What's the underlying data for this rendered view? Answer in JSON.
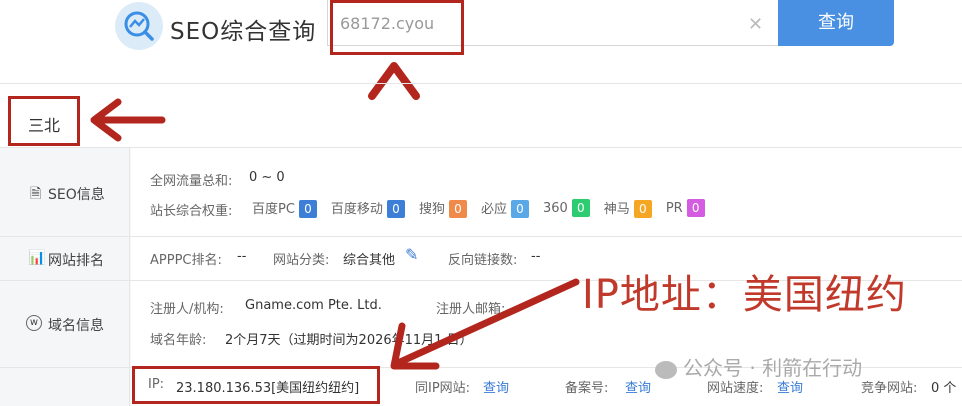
{
  "header": {
    "brand": "SEO综合查询",
    "search_value": "68172.cyou",
    "search_button": "查询"
  },
  "tab": {
    "label": "三北"
  },
  "seo_info": {
    "label": "SEO信息",
    "traffic_label": "全网流量总和:",
    "traffic_value": "0 ~ 0",
    "weight_label": "站长综合权重:",
    "engines": [
      {
        "name": "百度PC",
        "value": "0",
        "color": "#3d7fd6"
      },
      {
        "name": "百度移动",
        "value": "0",
        "color": "#3d7fd6"
      },
      {
        "name": "搜狗",
        "value": "0",
        "color": "#f08a4b"
      },
      {
        "name": "必应",
        "value": "0",
        "color": "#5aa9e6"
      },
      {
        "name": "360",
        "value": "0",
        "color": "#2ecc71"
      },
      {
        "name": "神马",
        "value": "0",
        "color": "#f5a623"
      },
      {
        "name": "PR",
        "value": "0",
        "color": "#d35ce0"
      }
    ]
  },
  "ranking": {
    "label": "网站排名",
    "apppc_label": "APPPC排名:",
    "apppc_value": "--",
    "category_label": "网站分类:",
    "category_value": "综合其他",
    "backlinks_label": "反向链接数:",
    "backlinks_value": "--"
  },
  "domain": {
    "label": "域名信息",
    "registrant_label": "注册人/机构:",
    "registrant_value": "Gname.com Pte. Ltd.",
    "email_label": "注册人邮箱:",
    "age_label": "域名年龄:",
    "age_value": "2个月7天（过期时间为2026年11月1 日）"
  },
  "ip_row": {
    "ip_label": "IP:",
    "ip_value": "23.180.136.53[美国纽约纽约]",
    "same_ip_label": "同IP网站:",
    "same_ip_link": "查询",
    "icp_label": "备案号:",
    "icp_link": "查询",
    "speed_label": "网站速度:",
    "speed_link": "查询",
    "competitor_label": "竞争网站:",
    "competitor_value": "0 个"
  },
  "annotation": {
    "text": "IP地址：美国纽约"
  },
  "watermark": {
    "text": "公众号 · 利箭在行动"
  }
}
